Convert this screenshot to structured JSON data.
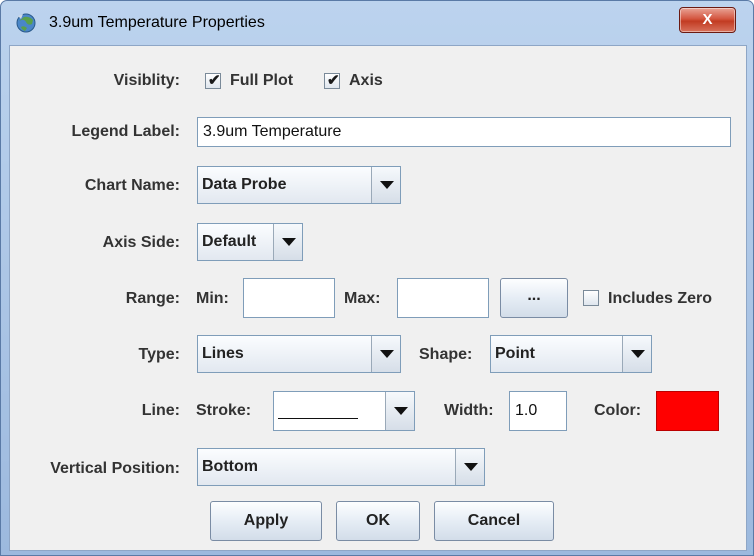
{
  "window": {
    "title": "3.9um Temperature Properties",
    "close_label": "X"
  },
  "visibility": {
    "label": "Visiblity:",
    "full_plot_label": "Full Plot",
    "full_plot_checked": true,
    "axis_label": "Axis",
    "axis_checked": true,
    "checkmark": "✔"
  },
  "legend": {
    "label": "Legend Label:",
    "value": "3.9um Temperature"
  },
  "chart_name": {
    "label": "Chart Name:",
    "value": "Data Probe"
  },
  "axis_side": {
    "label": "Axis Side:",
    "value": "Default"
  },
  "range": {
    "label": "Range:",
    "min_label": "Min:",
    "min_value": "",
    "max_label": "Max:",
    "max_value": "",
    "more_label": "...",
    "includes_zero_label": "Includes Zero",
    "includes_zero_checked": false
  },
  "type": {
    "label": "Type:",
    "value": "Lines",
    "shape_label": "Shape:",
    "shape_value": "Point"
  },
  "line": {
    "label": "Line:",
    "stroke_label": "Stroke:",
    "width_label": "Width:",
    "width_value": "1.0",
    "color_label": "Color:",
    "color": "#ff0000"
  },
  "vertical_position": {
    "label": "Vertical Position:",
    "value": "Bottom"
  },
  "buttons": {
    "apply": "Apply",
    "ok": "OK",
    "cancel": "Cancel"
  }
}
